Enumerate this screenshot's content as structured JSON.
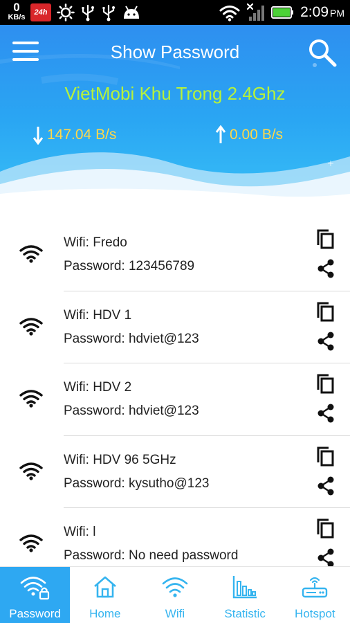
{
  "status_bar": {
    "speed_value": "0",
    "speed_unit": "KB/s",
    "badge_text": "24h",
    "time": "2:09",
    "ampm": "PM"
  },
  "header": {
    "title": "Show Password",
    "network_name": "VietMobi Khu Trong 2.4Ghz",
    "download_speed": "147.04 B/s",
    "upload_speed": "0.00 B/s"
  },
  "networks": [
    {
      "name": "Wifi: Fredo",
      "password": "Password: 123456789"
    },
    {
      "name": "Wifi: HDV 1",
      "password": "Password: hdviet@123"
    },
    {
      "name": "Wifi: HDV 2",
      "password": "Password: hdviet@123"
    },
    {
      "name": "Wifi: HDV 96 5GHz",
      "password": "Password: kysutho@123"
    },
    {
      "name": "Wifi: l",
      "password": "Password: No need password"
    }
  ],
  "bottom_nav": [
    {
      "label": "Password",
      "icon": "wifi-lock-icon",
      "active": true
    },
    {
      "label": "Home",
      "icon": "home-icon",
      "active": false
    },
    {
      "label": "Wifi",
      "icon": "wifi-icon",
      "active": false
    },
    {
      "label": "Statistic",
      "icon": "bar-chart-icon",
      "active": false
    },
    {
      "label": "Hotspot",
      "icon": "router-icon",
      "active": false
    }
  ],
  "colors": {
    "header_top": "#2e8ff0",
    "accent_blue": "#35b4ef",
    "network_green": "#b7f23a",
    "speed_yellow": "#ffd84a"
  }
}
